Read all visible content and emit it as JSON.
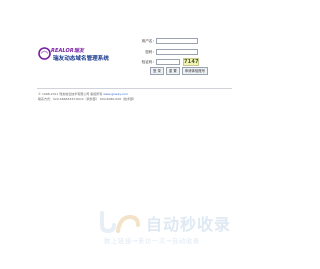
{
  "logo": {
    "brand": "REALOR瑞友",
    "title": "瑞友动态域名管理系统"
  },
  "login": {
    "username_label": "用户名：",
    "password_label": "密码：",
    "captcha_label": "验证码：",
    "captcha_code": "7147",
    "username_value": "",
    "password_value": "",
    "captcha_value": "",
    "login_button": "登 录",
    "reset_button": "重 置",
    "apply_button": "申请体验账号"
  },
  "footer": {
    "copyright": "© 1998-2011 瑞友信息技术有限公司 版权所有",
    "link_text": "www.gnway.com",
    "contact": "联系方式：020-66666333-8012（商务部） 400-6086-008（技术部）"
  },
  "watermark": {
    "title": "自动秒收录",
    "subtitle": "数上链接→来访一次→自动收录"
  },
  "colors": {
    "brand_purple": "#7a1fa2",
    "title_blue": "#1b3b8f",
    "watermark": "#dfe9f3"
  }
}
